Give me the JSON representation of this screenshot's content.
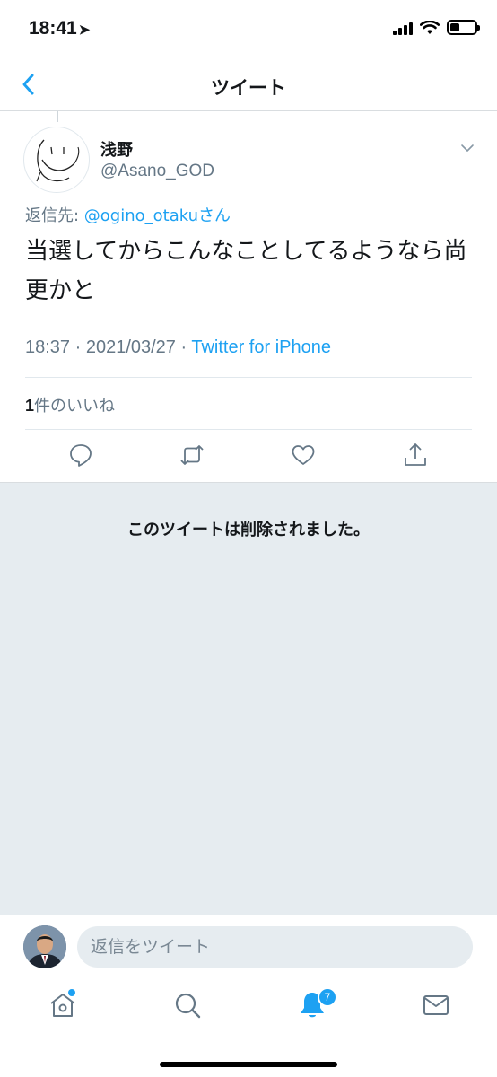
{
  "status_bar": {
    "time": "18:41",
    "location_arrow": "location-arrow-icon",
    "icons": [
      "cellular-signal-icon",
      "wifi-icon",
      "battery-icon"
    ]
  },
  "header": {
    "title": "ツイート",
    "back_icon": "chevron-left-icon"
  },
  "tweet": {
    "display_name": "浅野",
    "handle": "@Asano_GOD",
    "reply_prefix": "返信先: ",
    "reply_mention": "@ogino_otaku",
    "reply_suffix": "さん",
    "text": "当選してからこんなことしてるようなら尚更かと",
    "meta_time": "18:37 · 2021/03/27 · ",
    "meta_source": "Twitter for iPhone",
    "like_count": "1",
    "like_label": "件のいいね",
    "actions": [
      "reply-icon",
      "retweet-icon",
      "like-icon",
      "share-icon"
    ]
  },
  "deleted_notice": "このツイートは削除されました。",
  "reply_bar": {
    "placeholder": "返信をツイート"
  },
  "tab_bar": {
    "tabs": [
      "home-icon",
      "search-icon",
      "notifications-icon",
      "messages-icon"
    ],
    "notification_badge": "7"
  },
  "colors": {
    "accent": "#1da1f2",
    "secondary_text": "#657786",
    "deleted_background": "#e6ecf0"
  }
}
